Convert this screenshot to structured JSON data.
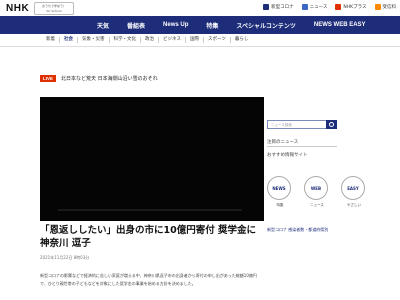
{
  "header": {
    "logo": "NHK",
    "school_line1": "おうちで学ぼう！",
    "school_line2": "for School",
    "links": [
      {
        "label": "新型コロナ",
        "color": "#1d2d7a"
      },
      {
        "label": "ニュース",
        "color": "#3a66c4"
      },
      {
        "label": "NHKプラス",
        "color": "#e03000"
      },
      {
        "label": "受信料",
        "color": "#ff8a00"
      }
    ]
  },
  "nav": {
    "items": [
      "天気",
      "番組表",
      "News Up",
      "特集",
      "スペシャルコンテンツ",
      "NEWS WEB EASY"
    ]
  },
  "subnav": {
    "items": [
      "新着",
      "社会",
      "気象・災害",
      "科学・文化",
      "政治",
      "ビジネス",
      "国際",
      "スポーツ",
      "暮らし"
    ],
    "active_index": 1
  },
  "live": {
    "badge": "LIVE",
    "text": "北日本など荒天 日本海側山沿い雪のおそれ"
  },
  "article": {
    "headline": "「恩返ししたい」出身の市に10億円寄付 奨学金に 神奈川 逗子",
    "date": "2021年11月22日 8時03分",
    "body": "新型コロナの影響などで経済的に苦しい家庭が増える中、神奈川県逗子市の出身者から寄付の申し出があった総額10億円で、ひとり親世帯の子どもなどを対象にした奨学金の事業を始める方針を決めました。"
  },
  "sidebar": {
    "search_placeholder": "ニュース検索",
    "heading": "注目のニュース",
    "subheading": "おすすめ情報サイト",
    "thumbs": [
      {
        "title": "NEWS",
        "label": "特集"
      },
      {
        "title": "WEB",
        "label": "ニュース"
      },
      {
        "title": "EASY",
        "label": "やさしい"
      }
    ],
    "link": "新型コロナ 感染者数・都道府県別"
  }
}
